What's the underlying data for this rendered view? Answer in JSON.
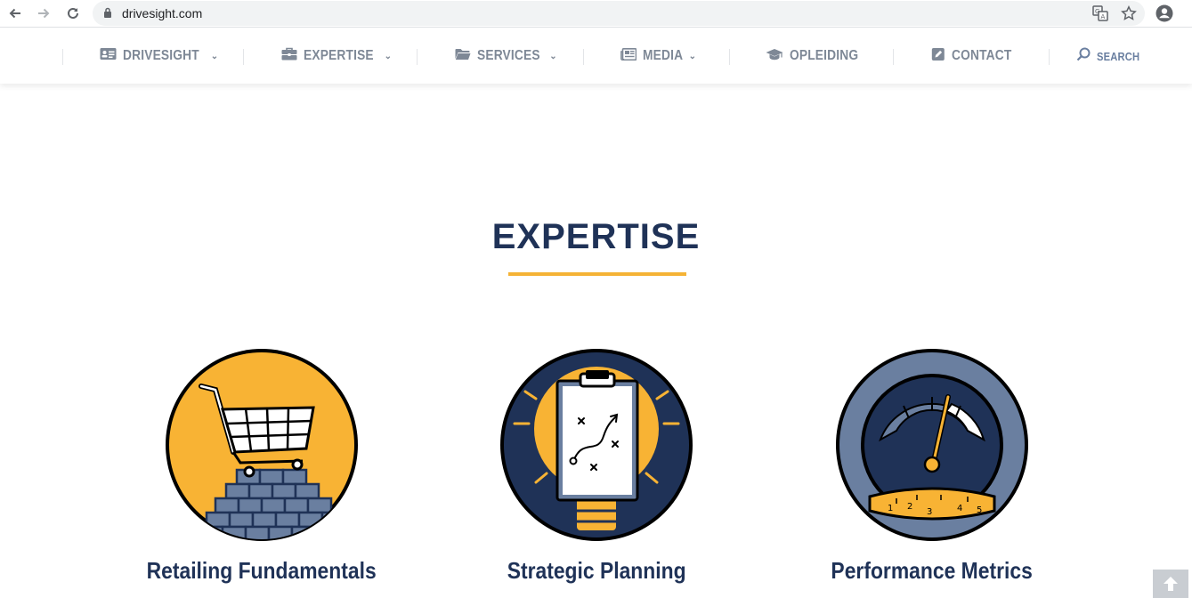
{
  "browser": {
    "url": "drivesight.com",
    "icons": [
      "back-icon",
      "forward-icon",
      "reload-icon",
      "lock-icon",
      "translate-icon",
      "star-icon",
      "account-icon"
    ]
  },
  "nav": {
    "items": [
      {
        "label": "DRIVESIGHT",
        "icon": "id-card-icon",
        "dropdown": true
      },
      {
        "label": "EXPERTISE",
        "icon": "toolbox-icon",
        "dropdown": true
      },
      {
        "label": "SERVICES",
        "icon": "folder-icon",
        "dropdown": true
      },
      {
        "label": "MEDIA",
        "icon": "newspaper-icon",
        "dropdown": true
      },
      {
        "label": "OPLEIDING",
        "icon": "graduation-cap-icon",
        "dropdown": false
      },
      {
        "label": "CONTACT",
        "icon": "edit-icon",
        "dropdown": false
      }
    ],
    "search_label": "SEARCH"
  },
  "expertise": {
    "title": "EXPERTISE",
    "cards": [
      {
        "title": "Retailing Fundamentals",
        "icon": "shopping-cart-on-bricks-icon"
      },
      {
        "title": "Strategic Planning",
        "icon": "clipboard-strategy-icon"
      },
      {
        "title": "Performance Metrics",
        "icon": "speedometer-gauge-icon"
      }
    ]
  },
  "colors": {
    "navy": "#1f3257",
    "gold": "#f5b335",
    "slate": "#6a7fa0",
    "menu_gray": "#7e8896"
  }
}
